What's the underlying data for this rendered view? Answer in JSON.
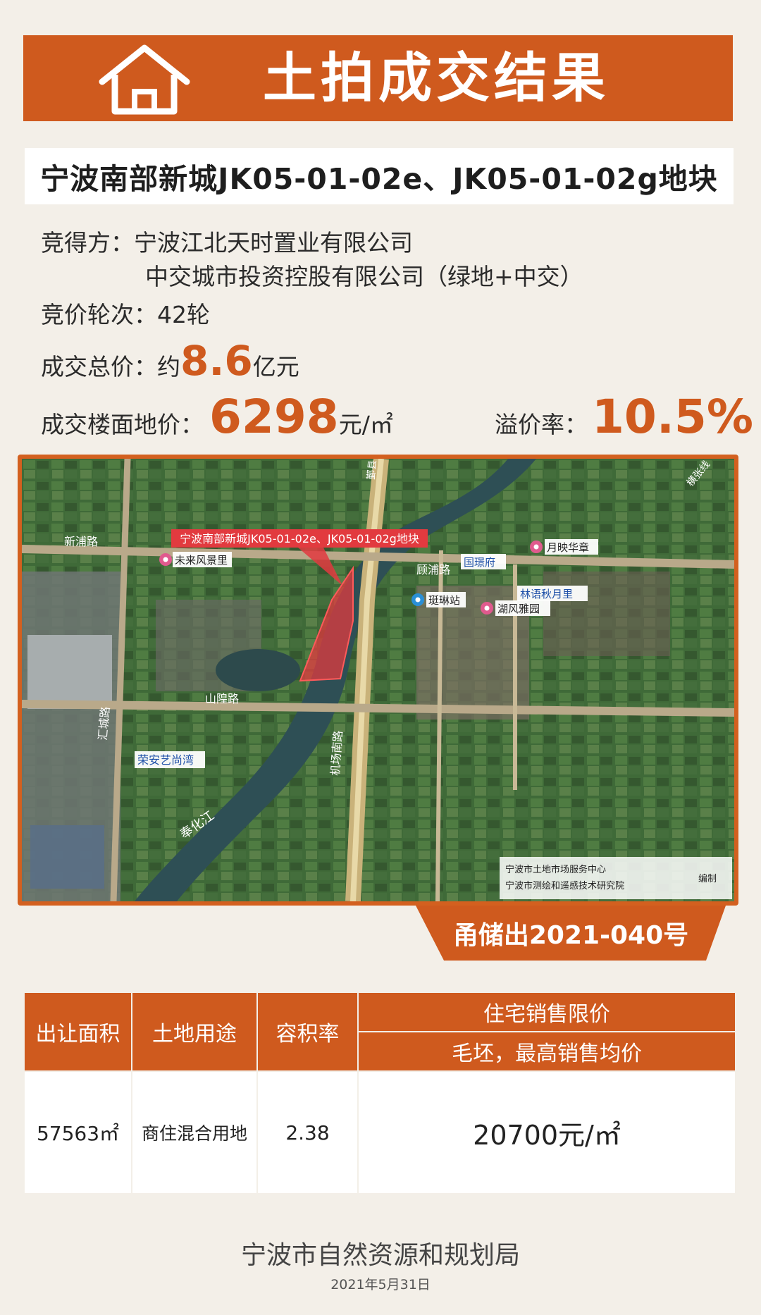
{
  "header": {
    "title": "土拍成交结果"
  },
  "plot_name": "宁波南部新城JK05-01-02e、JK05-01-02g地块",
  "winner": {
    "label": "竞得方：",
    "line1": "宁波江北天时置业有限公司",
    "line2": "中交城市投资控股有限公司（绿地+中交）"
  },
  "rounds": {
    "label": "竞价轮次：",
    "value": "42轮"
  },
  "total_price": {
    "label": "成交总价：",
    "prefix": "约",
    "value": "8.6",
    "unit": "亿元"
  },
  "floor_price": {
    "label": "成交楼面地价：",
    "value": "6298",
    "unit": "元/㎡"
  },
  "premium": {
    "label": "溢价率：",
    "value": "10.5%"
  },
  "map": {
    "callout": "宁波南部新城JK05-01-02e、JK05-01-02g地块",
    "roads": {
      "xinyong": "新浦路",
      "shanhuang": "山隍路",
      "huicheng": "汇城路",
      "jichang": "机场南路",
      "gu": "顾浦路",
      "river": "奉化江",
      "heng": "横张线",
      "north": "鄞县"
    },
    "pois": {
      "weilai": "未来风景里",
      "yueying": "月映华章",
      "guojing": "国璟府",
      "linyu": "林语秋月里",
      "huxin": "湖风雅园",
      "station": "珽琳站",
      "rongan": "荣安艺尚湾"
    },
    "credit1": "宁波市土地市场服务中心",
    "credit2": "宁波市测绘和遥感技术研究院",
    "credit3": "编制"
  },
  "doc_number": "甬储出2021-040号",
  "table": {
    "headers": [
      "出让面积",
      "土地用途",
      "容积率",
      "住宅销售限价",
      "毛坯，最高销售均价"
    ],
    "row": [
      "57563㎡",
      "商住混合用地",
      "2.38",
      "20700元/㎡"
    ]
  },
  "footer": {
    "org": "宁波市自然资源和规划局",
    "date": "2021年5月31日"
  },
  "colors": {
    "accent": "#cf5a1e",
    "background": "#f3efe8"
  }
}
